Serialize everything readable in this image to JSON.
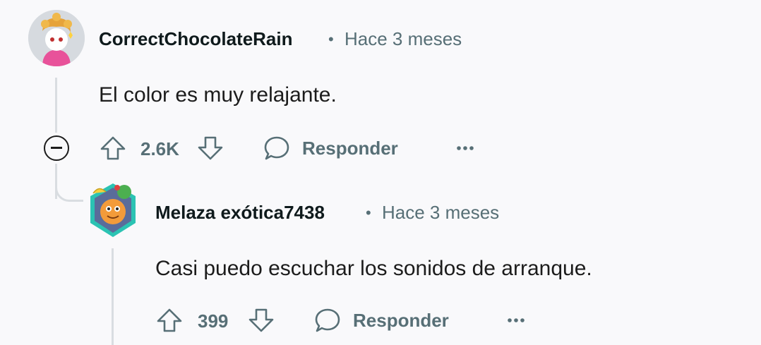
{
  "comments": [
    {
      "username": "CorrectChocolateRain",
      "time": "Hace 3 meses",
      "body": "El color es muy relajante.",
      "votes": "2.6K",
      "reply_label": "Responder",
      "avatar_icon": "snoo-avatar-icon"
    },
    {
      "username": "Melaza exótica7438",
      "time": "Hace 3 meses",
      "body": "Casi puedo escuchar los sonidos de arranque.",
      "votes": "399",
      "reply_label": "Responder",
      "avatar_icon": "snoo-avatar-icon"
    }
  ],
  "separator": "•",
  "colors": {
    "meta": "#576f76",
    "text": "#1c1c1c",
    "thread": "#d9dde1",
    "background": "#f9f9fb"
  }
}
